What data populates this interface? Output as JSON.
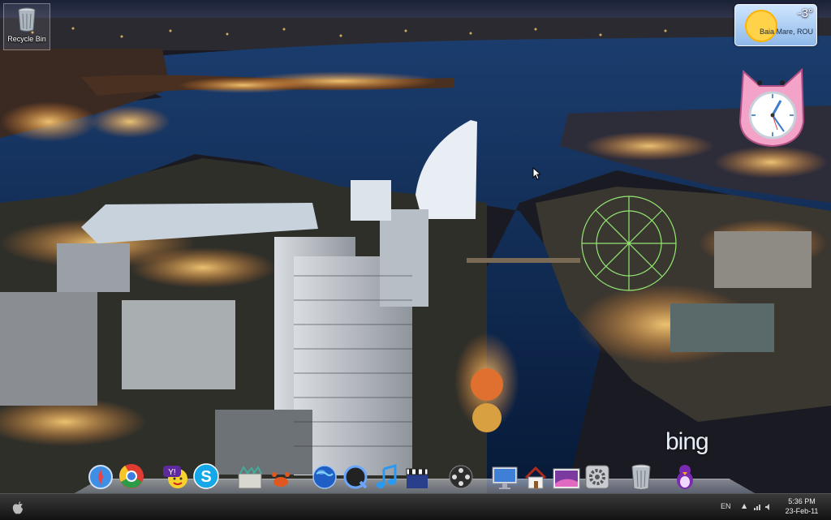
{
  "desktop": {
    "recycle_bin_label": "Recycle Bin"
  },
  "weather": {
    "temperature": "-3°",
    "location": "Baia Mare, ROU",
    "icon": "sun-icon"
  },
  "clock_widget": {
    "icon": "pink-cat-clock-icon"
  },
  "wallpaper": {
    "brand": "bing",
    "scene": "city-harbor-night"
  },
  "dock": {
    "items": [
      {
        "name": "safari-icon"
      },
      {
        "name": "chrome-icon"
      },
      {
        "name": "yahoo-messenger-icon"
      },
      {
        "name": "skype-icon"
      },
      {
        "name": "box-app-icon"
      },
      {
        "name": "crab-app-icon"
      },
      {
        "name": "globe-icon"
      },
      {
        "name": "quicktime-icon"
      },
      {
        "name": "itunes-icon"
      },
      {
        "name": "movie-clapper-icon"
      },
      {
        "name": "film-reel-icon"
      },
      {
        "name": "monitor-icon"
      },
      {
        "name": "home-icon"
      },
      {
        "name": "photo-icon"
      },
      {
        "name": "settings-icon"
      },
      {
        "name": "trash-icon"
      },
      {
        "name": "penguin-icon"
      }
    ]
  },
  "taskbar": {
    "language": "EN",
    "time": "5:36 PM",
    "date": "23-Feb-11"
  },
  "colors": {
    "taskbar_bg": "#1c1c1c",
    "water": "#0d2347",
    "lights": "#ffb347"
  }
}
